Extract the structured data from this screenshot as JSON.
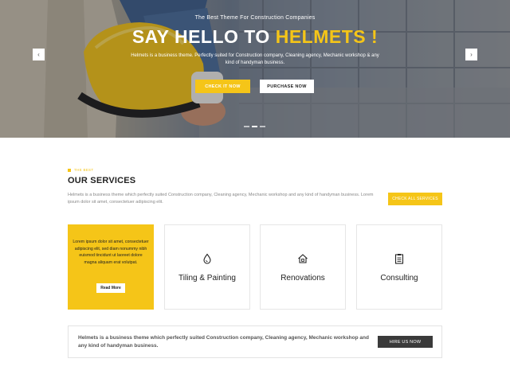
{
  "hero": {
    "subtitle": "The Best Theme For Construction Companies",
    "title_main": "SAY HELLO TO ",
    "title_accent": "HELMETS !",
    "description": "Helmets is a business theme. Perfectly suited for Construction company, Cleaning agency, Mechanic workshop & any kind of handyman business.",
    "btn_check": "CHECK IT NOW",
    "btn_purchase": "PURCHASE NOW",
    "arrow_prev": "‹",
    "arrow_next": "›",
    "slides_total": 3,
    "active_slide": 1
  },
  "services": {
    "eyebrow": "THE BEST",
    "title": "OUR SERVICES",
    "description": "Helmets is a business theme which perfectly suited Construction company, Cleaning agency, Mechanic workshop and any kind of handyman business. Lorem ipsum dolor sit amet, consectetuer adipiscing elit.",
    "btn_all": "CHECK ALL SERVICES",
    "cards": [
      {
        "text": "Lorem ipsum dolor sit amet, consectetuer adipiscing elit, sed diam nonummy nibh euismod tincidunt ut laoreet dolore magna aliquam erat volutpat.",
        "button": "Read More"
      },
      {
        "label": "Tiling & Painting",
        "icon": "paint-drop-icon"
      },
      {
        "label": "Renovations",
        "icon": "house-icon"
      },
      {
        "label": "Consulting",
        "icon": "clipboard-icon"
      }
    ]
  },
  "cta": {
    "text": "Helmets is a business theme which perfectly suited Construction company, Cleaning agency, Mechanic workshop and any kind of handyman business.",
    "button": "HIRE US NOW"
  },
  "colors": {
    "accent": "#f5c518",
    "dark_button": "#3a3a3a"
  }
}
